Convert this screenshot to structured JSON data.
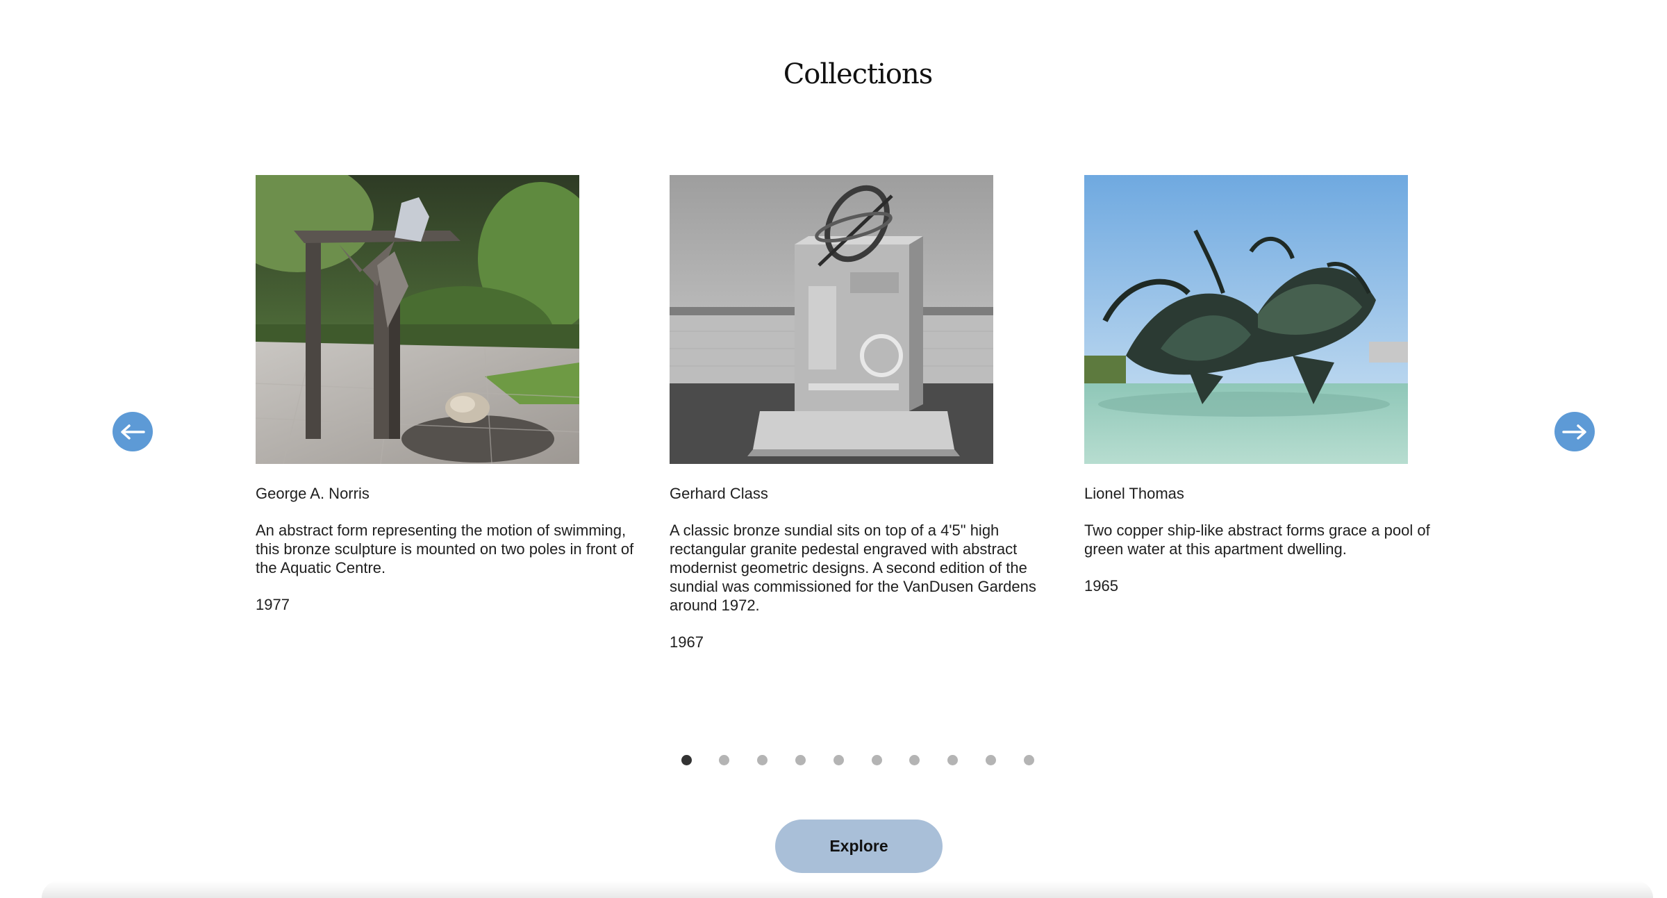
{
  "section": {
    "title": "Collections"
  },
  "carousel": {
    "cards": [
      {
        "artist": "George A. Norris",
        "description": "An abstract form representing the motion of swimming, this bronze sculpture is mounted on two poles in front of the Aquatic Centre.",
        "year": "1977"
      },
      {
        "artist": "Gerhard Class",
        "description": "A classic bronze sundial sits on top of a 4'5\" high rectangular granite pedestal engraved with abstract modernist geometric designs. A second edition of the sundial was commissioned for the VanDusen Gardens around 1972.",
        "year": "1967"
      },
      {
        "artist": "Lionel Thomas",
        "description": "Two copper ship-like abstract forms grace a pool of green water at this apartment dwelling.",
        "year": "1965"
      }
    ],
    "prev_icon": "arrow-left-icon",
    "next_icon": "arrow-right-icon",
    "page_count": 10,
    "active_page": 1
  },
  "explore_label": "Explore",
  "colors": {
    "arrow_bg": "#5d9ad6",
    "explore_bg": "#a9bfd8",
    "dot_active": "#333333",
    "dot_inactive": "#b4b4b4"
  }
}
